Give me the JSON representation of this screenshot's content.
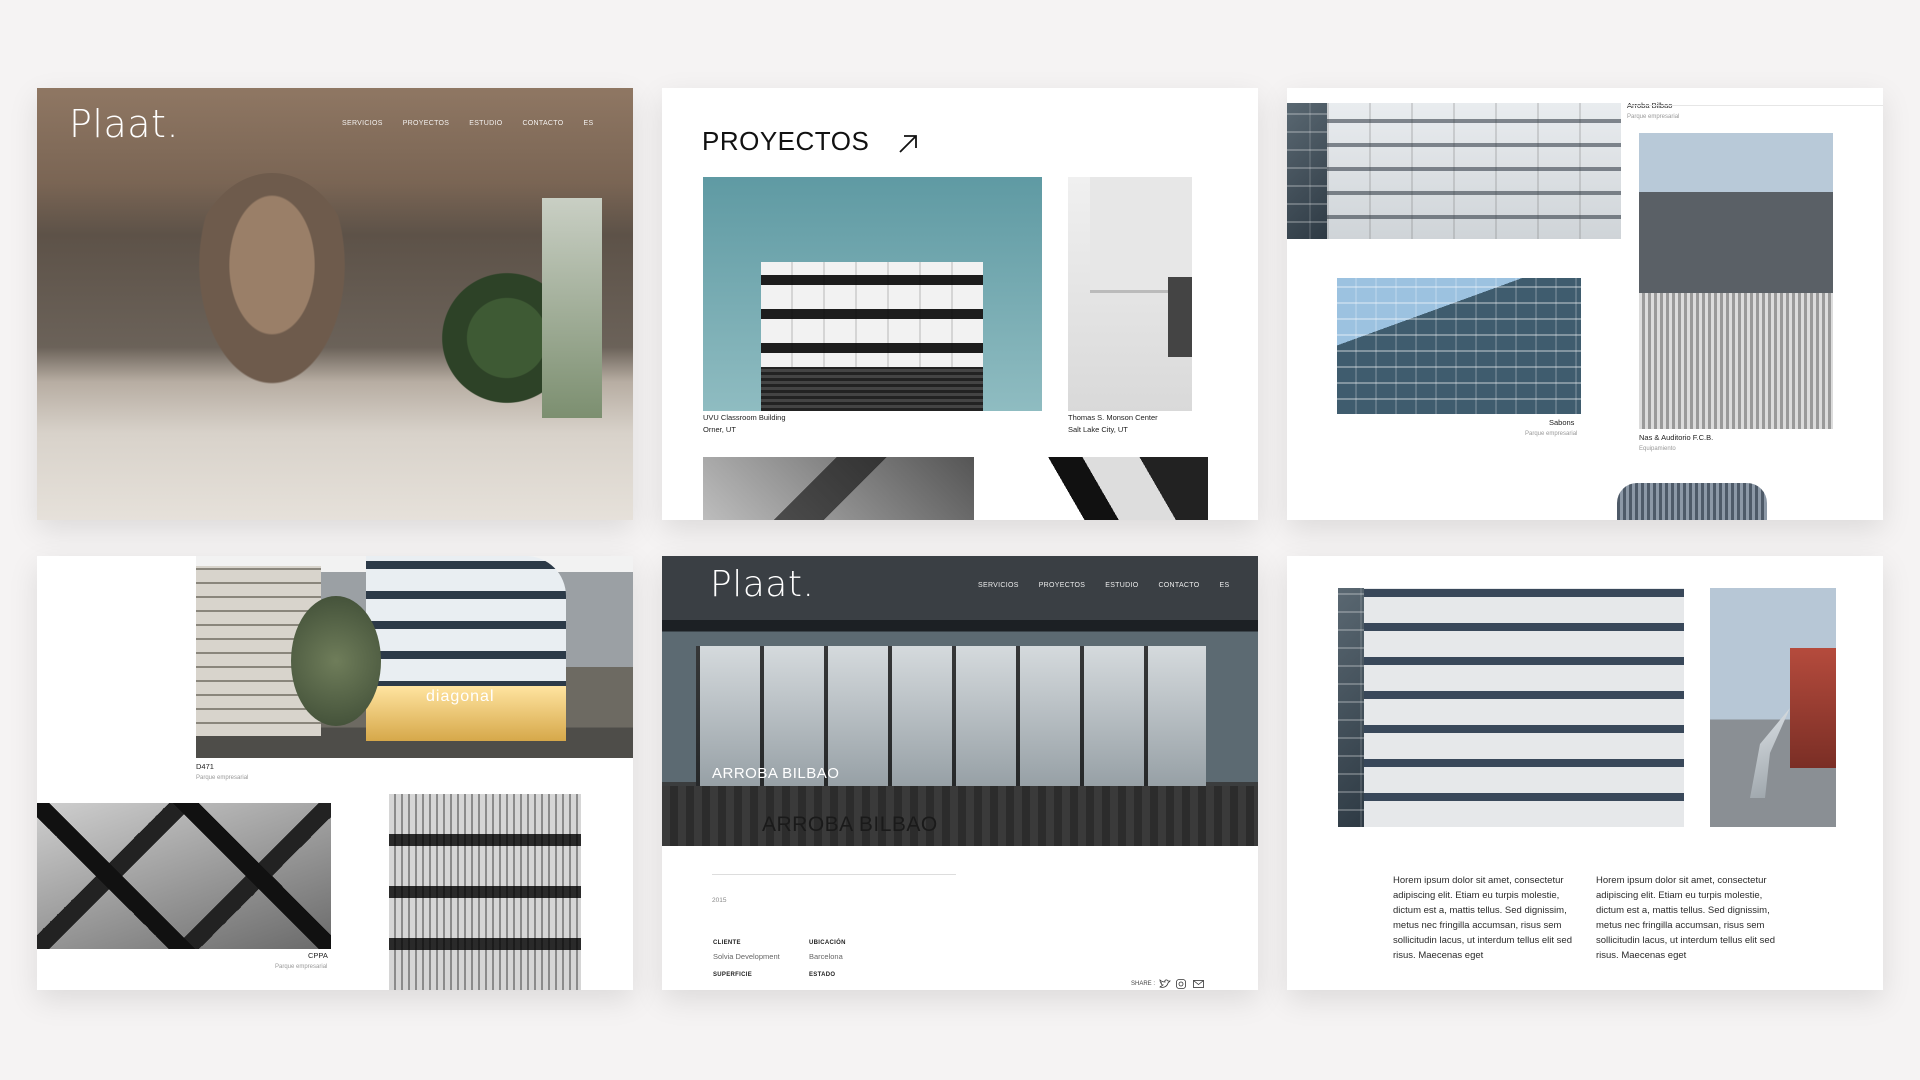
{
  "brand": {
    "logo": "Plaat."
  },
  "nav": {
    "items": [
      "SERVICIOS",
      "PROYECTOS",
      "ESTUDIO",
      "CONTACTO",
      "ES"
    ]
  },
  "card2": {
    "heading": "PROYECTOS",
    "projects": [
      {
        "title": "UVU Classroom Building",
        "location": "Orner, UT"
      },
      {
        "title": "Thomas S. Monson Center",
        "location": "Salt Lake City, UT"
      }
    ]
  },
  "card3": {
    "projects": [
      {
        "title": "Arroba Bilbao",
        "type": "Parque empresarial"
      },
      {
        "title": "Sabons",
        "type": "Parque empresarial"
      },
      {
        "title": "Nas & Auditorio F.C.B.",
        "type": "Equipamiento"
      }
    ]
  },
  "card4": {
    "projects": [
      {
        "title": "D471",
        "type": "Parque empresarial"
      },
      {
        "title": "CPPA",
        "type": "Parque empresarial"
      }
    ],
    "building_sign": "diagonal"
  },
  "card5": {
    "hero_small": "ARROBA BILBAO",
    "hero_large": "ARROBA BILBAO",
    "year": "2015",
    "details": [
      {
        "label": "CLIENTE",
        "value": "Solvia Development"
      },
      {
        "label": "UBICACIÓN",
        "value": "Barcelona"
      },
      {
        "label": "SUPERFICIE",
        "value": ""
      },
      {
        "label": "ESTADO",
        "value": ""
      }
    ],
    "share_label": "SHARE :"
  },
  "card6": {
    "paragraphs": [
      "Horem ipsum dolor sit amet, consectetur adipiscing elit. Etiam eu turpis molestie, dictum est a, mattis tellus. Sed dignissim, metus nec fringilla accumsan, risus sem sollicitudin lacus, ut interdum tellus elit sed risus. Maecenas eget",
      "Horem ipsum dolor sit amet, consectetur adipiscing elit. Etiam eu turpis molestie, dictum est a, mattis tellus. Sed dignissim, metus nec fringilla accumsan, risus sem sollicitudin lacus, ut interdum tellus elit sed risus. Maecenas eget"
    ]
  }
}
